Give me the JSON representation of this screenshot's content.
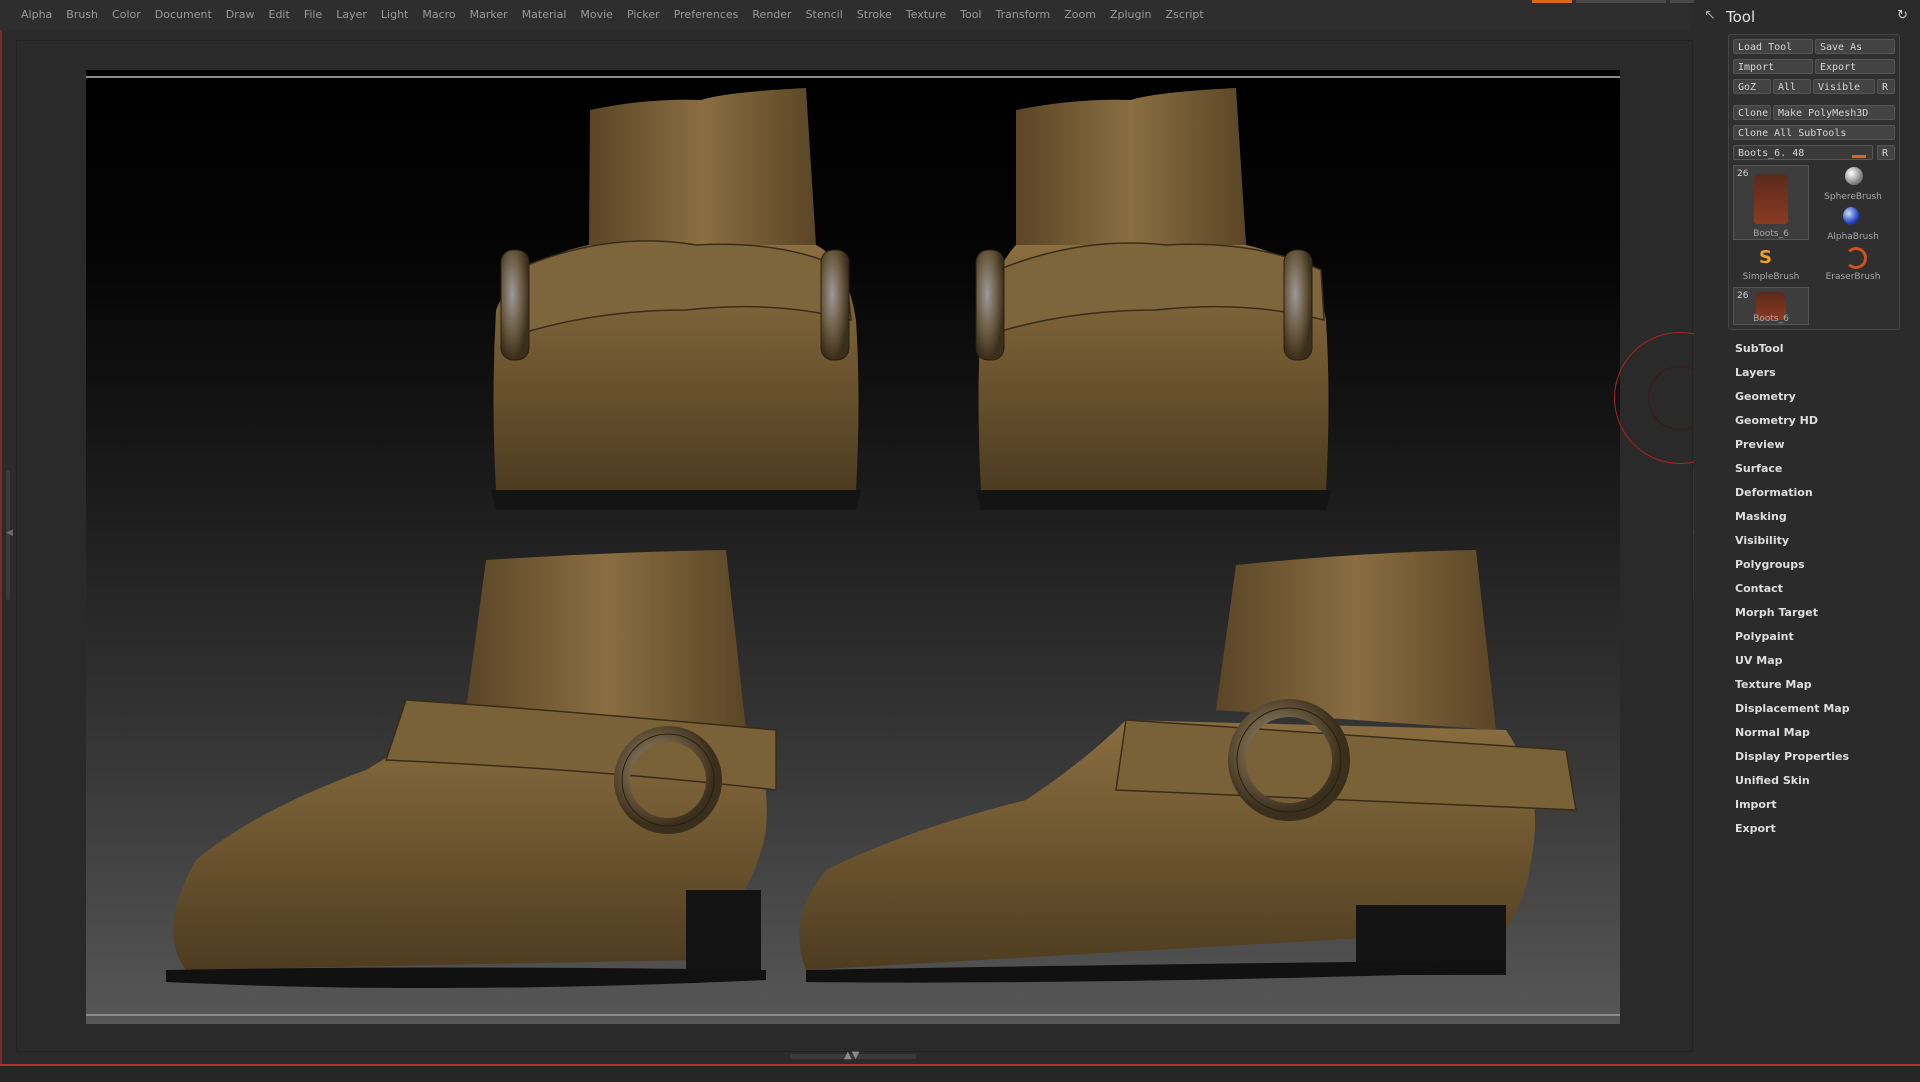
{
  "menu": [
    "Alpha",
    "Brush",
    "Color",
    "Document",
    "Draw",
    "Edit",
    "File",
    "Layer",
    "Light",
    "Macro",
    "Marker",
    "Material",
    "Movie",
    "Picker",
    "Preferences",
    "Render",
    "Stencil",
    "Stroke",
    "Texture",
    "Tool",
    "Transform",
    "Zoom",
    "Zplugin",
    "Zscript"
  ],
  "panel": {
    "title": "Tool",
    "buttons": {
      "load_tool": "Load Tool",
      "save_as": "Save As",
      "import": "Import",
      "export": "Export",
      "goz": "GoZ",
      "all": "All",
      "visible": "Visible",
      "r": "R",
      "clone": "Clone",
      "make_polymesh": "Make PolyMesh3D",
      "clone_all": "Clone All SubTools"
    },
    "slider": {
      "label": "Boots_6.",
      "value": "48",
      "r": "R"
    },
    "tools": [
      {
        "num": "26",
        "label": "Boots_6"
      },
      {
        "label": "SphereBrush"
      },
      {
        "label": "AlphaBrush"
      },
      {
        "label": "SimpleBrush"
      },
      {
        "label": "EraserBrush"
      },
      {
        "num": "26",
        "label": "Boots_6"
      }
    ],
    "sections": [
      "SubTool",
      "Layers",
      "Geometry",
      "Geometry HD",
      "Preview",
      "Surface",
      "Deformation",
      "Masking",
      "Visibility",
      "Polygroups",
      "Contact",
      "Morph Target",
      "Polypaint",
      "UV Map",
      "Texture Map",
      "Displacement Map",
      "Normal Map",
      "Display Properties",
      "Unified Skin",
      "Import",
      "Export"
    ]
  },
  "colors": {
    "accent": "#e0641f",
    "leather": "#7a6238",
    "sole": "#151515",
    "ring": "#5a4a30"
  }
}
